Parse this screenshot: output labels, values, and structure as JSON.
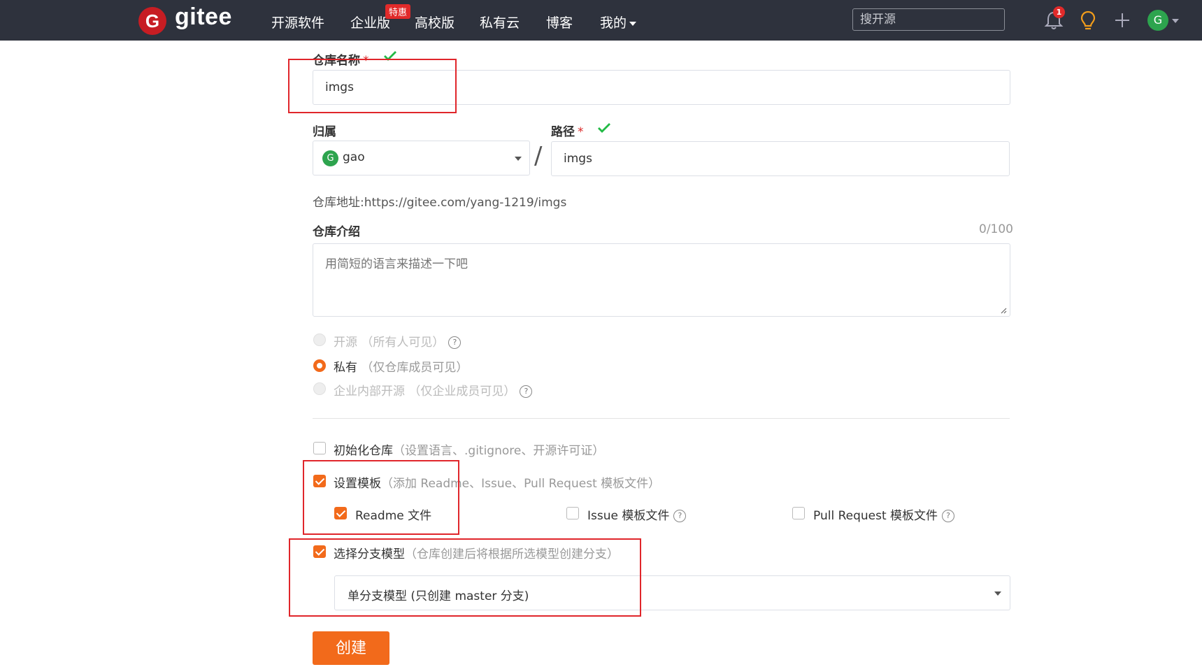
{
  "nav": {
    "logo_letter": "G",
    "logo_text": "gitee",
    "items": [
      "开源软件",
      "企业版",
      "高校版",
      "私有云",
      "博客",
      "我的"
    ],
    "hot_badge": "特惠",
    "search_placeholder": "搜开源",
    "notif_count": "1",
    "avatar_letter": "G",
    "colors": {
      "bar": "#2e323d",
      "logo": "#c71d23",
      "badge": "#e12a2a"
    }
  },
  "form": {
    "repo_name_label": "仓库名称",
    "repo_name_value": "imgs",
    "owner_label": "归属",
    "owner_avatar": "G",
    "owner_value": "gao",
    "slash": "/",
    "path_label": "路径",
    "path_value": "imgs",
    "required_mark": "*",
    "repo_url_label": "仓库地址:",
    "repo_url": "https://gitee.com/yang-1219/imgs",
    "desc_label": "仓库介绍",
    "desc_counter": "0/100",
    "desc_placeholder": "用简短的语言来描述一下吧",
    "visibility": [
      {
        "label": "开源",
        "note": "（所有人可见）",
        "help": "?",
        "state": "disabled"
      },
      {
        "label": "私有",
        "note": "（仅仓库成员可见）",
        "state": "selected"
      },
      {
        "label": "企业内部开源",
        "note": "（仅企业成员可见）",
        "help": "?",
        "state": "disabled"
      }
    ],
    "init_repo": {
      "label": "初始化仓库",
      "note": "（设置语言、.gitignore、开源许可证）",
      "checked": false
    },
    "set_template": {
      "label": "设置模板",
      "note": "（添加 Readme、Issue、Pull Request 模板文件）",
      "checked": true
    },
    "templates": [
      {
        "label": "Readme 文件",
        "checked": true
      },
      {
        "label": "Issue 模板文件",
        "checked": false,
        "help": "?"
      },
      {
        "label": "Pull Request 模板文件",
        "checked": false,
        "help": "?"
      }
    ],
    "branch_model": {
      "label": "选择分支模型",
      "note": "（仓库创建后将根据所选模型创建分支）",
      "checked": true
    },
    "branch_select_value": "单分支模型 (只创建 master 分支)",
    "create_button": "创建",
    "accent_color": "#f26a1b"
  }
}
